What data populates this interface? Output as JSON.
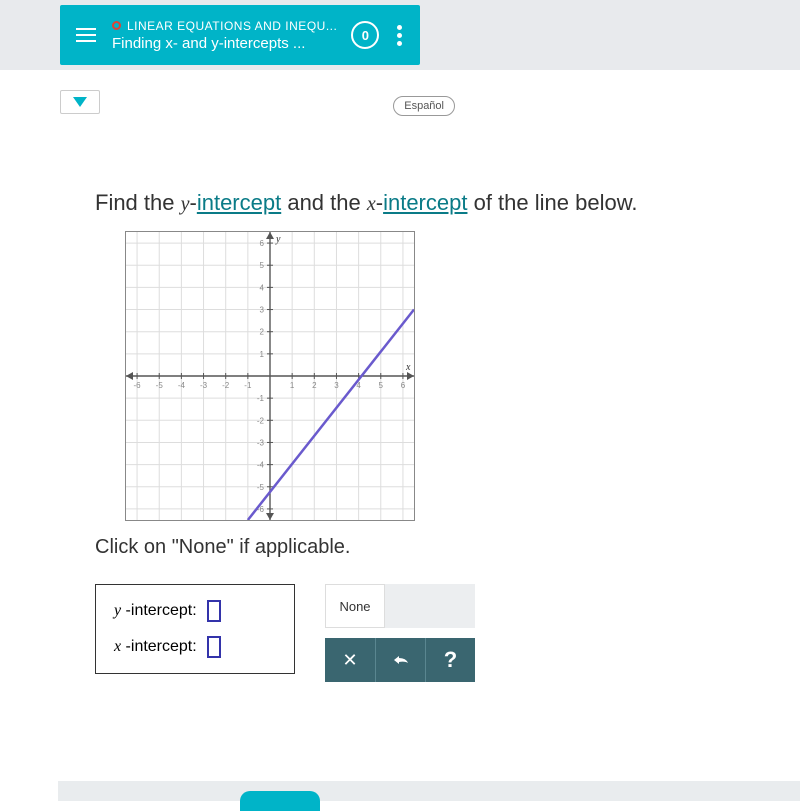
{
  "header": {
    "category_prefix": "LINEAR EQUATIONS AND INEQU...",
    "topic": "Finding x- and y-intercepts ...",
    "counter": "0"
  },
  "lang_button": "Español",
  "question": {
    "pre": "Find the ",
    "y_var": "y",
    "y_link": "intercept",
    "mid": " and the ",
    "x_var": "x",
    "x_link": "intercept",
    "post": " of the line below."
  },
  "instruction": "Click on \"None\" if applicable.",
  "answers": {
    "y_label_var": "y",
    "y_label_text": " -intercept:",
    "x_label_var": "x",
    "x_label_text": " -intercept:"
  },
  "tools": {
    "none": "None",
    "close": "✕",
    "undo": "↶",
    "help": "?"
  },
  "chart_data": {
    "type": "line",
    "title": "",
    "xlabel": "x",
    "ylabel": "y",
    "xlim": [
      -6.5,
      6.5
    ],
    "ylim": [
      -6.5,
      6.5
    ],
    "x_ticks": [
      -6,
      -5,
      -4,
      -3,
      -2,
      -1,
      1,
      2,
      3,
      4,
      5,
      6
    ],
    "y_ticks": [
      -6,
      -5,
      -4,
      -3,
      -2,
      -1,
      1,
      2,
      3,
      4,
      5,
      6
    ],
    "series": [
      {
        "name": "line",
        "points": [
          [
            -1,
            -6.5
          ],
          [
            6.5,
            3
          ]
        ],
        "color": "#6a5acd"
      }
    ],
    "derived": {
      "slope": 1.2667,
      "x_intercept": 4.13,
      "y_intercept_offscreen": true
    }
  }
}
